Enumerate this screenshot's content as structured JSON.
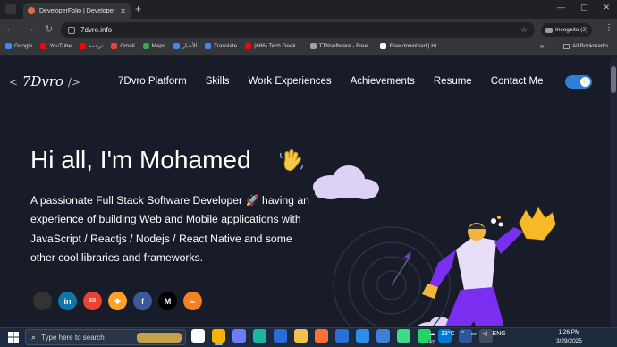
{
  "browser": {
    "tab_title": "DeveloperFolio | Developer Po",
    "tab_close": "✕",
    "new_tab": "+",
    "window_controls": [
      "—",
      "▢",
      "✕"
    ],
    "nav_buttons": [
      "←",
      "→",
      "↻"
    ],
    "url": "7dvro.info",
    "incognito_label": "Incognito (2)",
    "menu": "⋮",
    "bookmarks": [
      {
        "label": "Google",
        "color": "#4285f4"
      },
      {
        "label": "YouTube",
        "color": "#ff0000"
      },
      {
        "label": "ترجمة",
        "color": "#ff0000"
      },
      {
        "label": "Gmail",
        "color": "#ea4335"
      },
      {
        "label": "Maps",
        "color": "#34a853"
      },
      {
        "label": "الأخبار",
        "color": "#4285f4"
      },
      {
        "label": "Translate",
        "color": "#4285f4"
      },
      {
        "label": "(686) Tech Geek ...",
        "color": "#ff0000"
      },
      {
        "label": "TTNsoftware - Free...",
        "color": "#9aa0a6"
      },
      {
        "label": "Free download | Hi...",
        "color": "#ffffff"
      }
    ],
    "bookmarks_more": "»",
    "all_bookmarks": "All Bookmarks"
  },
  "site": {
    "logo_text": "7Dvro",
    "logo_open": "<",
    "logo_close": "/>",
    "nav": [
      "7Dvro Platform",
      "Skills",
      "Work Experiences",
      "Achievements",
      "Resume",
      "Contact Me"
    ],
    "toggle_icon": "☾",
    "greeting": "Hi all, I'm Mohamed",
    "bio": "A passionate Full Stack Software Developer 🚀 having an experience of building Web and Mobile applications with JavaScript / Reactjs / Nodejs / React Native and some other cool libraries and frameworks.",
    "social": [
      {
        "name": "github",
        "glyph": "",
        "color": "#333333"
      },
      {
        "name": "linkedin",
        "glyph": "in",
        "color": "#0e76a8"
      },
      {
        "name": "gmail",
        "glyph": "✉",
        "color": "#ea4335"
      },
      {
        "name": "gitlab",
        "glyph": "◆",
        "color": "#fca326"
      },
      {
        "name": "facebook",
        "glyph": "f",
        "color": "#3b5998"
      },
      {
        "name": "medium",
        "glyph": "M",
        "color": "#000000"
      },
      {
        "name": "stackoverflow",
        "glyph": "≡",
        "color": "#f48024"
      }
    ]
  },
  "taskbar": {
    "search_placeholder": "Type here to search",
    "apps": [
      {
        "name": "task-view",
        "color": "#ffffff"
      },
      {
        "name": "chrome",
        "color": "#f4b400",
        "active": true
      },
      {
        "name": "copilot",
        "color": "#6b7cff"
      },
      {
        "name": "edge",
        "color": "#1fb4a0"
      },
      {
        "name": "mail",
        "color": "#2b6cd9"
      },
      {
        "name": "files",
        "color": "#f2c14e"
      },
      {
        "name": "firefox",
        "color": "#ff7139"
      },
      {
        "name": "store",
        "color": "#2d6fd8"
      },
      {
        "name": "vscode",
        "color": "#2c8ee8"
      },
      {
        "name": "photos",
        "color": "#3f7fd8"
      },
      {
        "name": "android-studio",
        "color": "#3ddc84"
      },
      {
        "name": "whatsapp",
        "color": "#25d366"
      },
      {
        "name": "mail-app",
        "color": "#0078d4"
      },
      {
        "name": "word",
        "color": "#2b579a"
      },
      {
        "name": "terminal",
        "color": "#444c5c"
      }
    ],
    "whatsapp_badge": "42",
    "temperature": "33°C",
    "language": "ENG",
    "time": "1:26 PM",
    "date": "3/29/2025"
  }
}
